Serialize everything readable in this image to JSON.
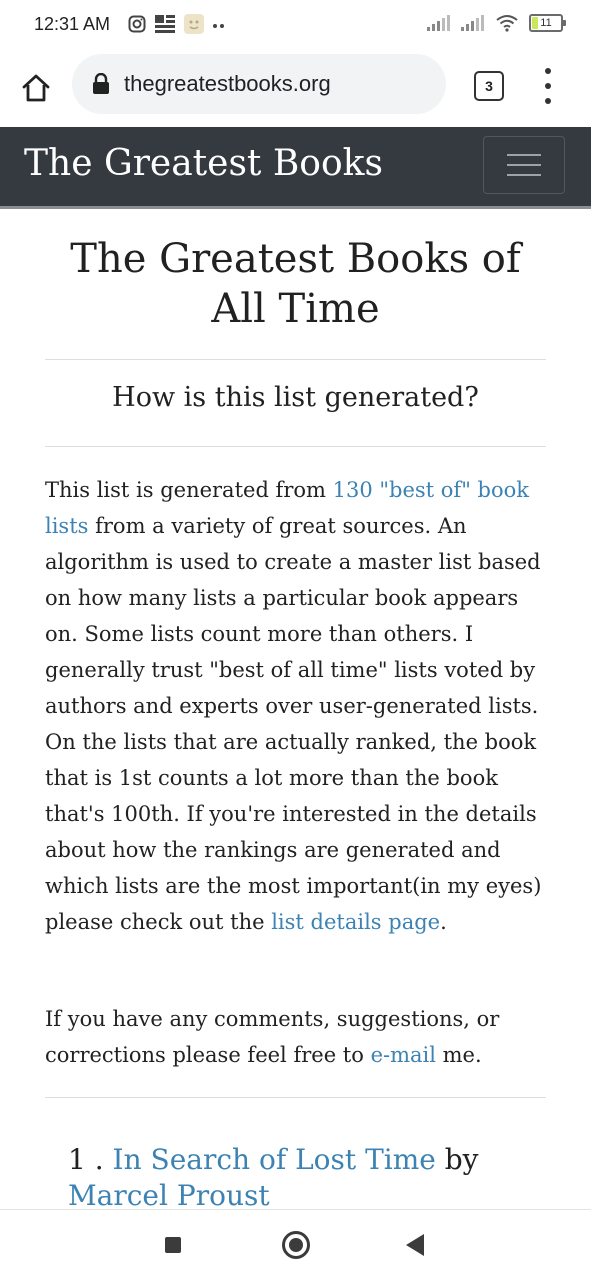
{
  "status_bar": {
    "time": "12:31 AM",
    "battery": "11",
    "icons": [
      "instagram-icon",
      "news-icon",
      "emoji-icon",
      "signal-icon",
      "signal-icon",
      "wifi-icon",
      "battery-icon"
    ]
  },
  "browser": {
    "url": "thegreatestbooks.org",
    "tab_count": "3"
  },
  "site": {
    "brand": "The Greatest Books"
  },
  "main": {
    "title": "The Greatest Books of All Time",
    "subtitle": "How is this list generated?",
    "para1": {
      "text1": "This list is generated from ",
      "link1": "130 \"best of\" book lists",
      "text2": " from a variety of great sources. An algorithm is used to create a master list based on how many lists a particular book appears on. Some lists count more than others. I generally trust \"best of all time\" lists voted by authors and experts over user-generated lists. On the lists that are actually ranked, the book that is 1st counts a lot more than the book that's 100th. If you're interested in the details about how the rankings are generated and which lists are the most important(in my eyes) please check out the ",
      "link2": "list details page",
      "text3": "."
    },
    "para2": {
      "text1": "If you have any comments, suggestions, or corrections please feel free to ",
      "link": "e-mail",
      "text2": " me."
    },
    "books": [
      {
        "rank": "1 .",
        "title": "In Search of Lost Time",
        "by": "by",
        "author": "Marcel Proust"
      }
    ]
  },
  "colors": {
    "navbar": "#343a40",
    "link": "#3c82b3",
    "url_pill": "#f1f3f4"
  }
}
